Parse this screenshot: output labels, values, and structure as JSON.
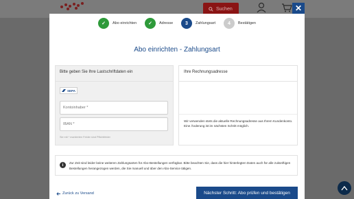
{
  "header": {
    "search_label": "Suchen"
  },
  "modal": {
    "close_label": "✕",
    "title": "Abo einrichten - Zahlungsart",
    "steps": [
      {
        "number": "✓",
        "label": "Abo einrichten",
        "state": "done"
      },
      {
        "number": "✓",
        "label": "Adresse",
        "state": "done"
      },
      {
        "number": "3",
        "label": "Zahlungsart",
        "state": "active"
      },
      {
        "number": "4",
        "label": "Bestätigen",
        "state": "pending"
      }
    ],
    "payment": {
      "heading": "Bitte geben Sie Ihre Lastschriftdaten ein",
      "sepa_label": "SEPA",
      "account_holder_placeholder": "Kontoinhaber *",
      "iban_placeholder": "IBAN *",
      "required_note": "Sie mit * markierten Felder sind Pflichtfelder"
    },
    "billing": {
      "heading": "Ihre Rechnungsadresse",
      "note": "Wir verwenden stets die aktuelle Rechnungsadresse aus Ihrem Kundenkonto. Eine Änderung ist im nächsten Schritt möglich."
    },
    "info": {
      "text": "Zur Zeit sind leider keine weiteren Zahlungsarten für Abo-Bestellungen verfügbar. Bitte beachten Sie, dass die hier hinterlegten Daten auch für alle zukünftigen Bestellungen herangezogen werden, die Sie manuell und über den Abo-Service tätigen."
    },
    "back_label": "Zurück zu Versand",
    "next_label": "Nächster Schritt: Abo prüfen und bestätigen"
  },
  "colors": {
    "primary": "#1a4a8a",
    "done": "#2e9a3a",
    "pending": "#cccccc",
    "search_bg": "#8a1414"
  },
  "icons": [
    "logo-icon",
    "search-icon",
    "user-icon",
    "cart-icon",
    "close-icon",
    "check-icon",
    "sepa-icon",
    "info-icon",
    "arrow-left-icon",
    "arrow-up-icon"
  ]
}
